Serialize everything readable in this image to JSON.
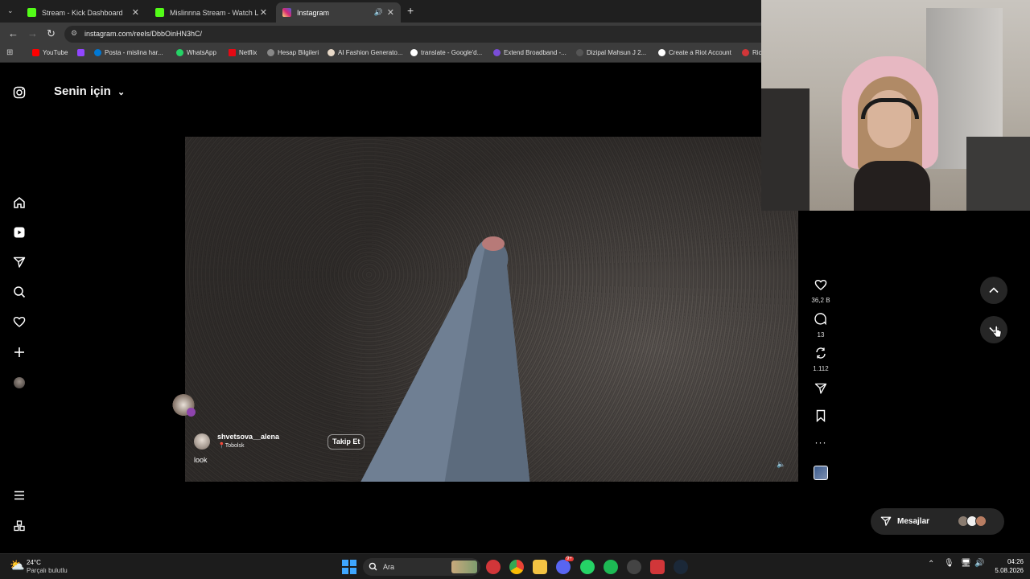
{
  "tabs": [
    {
      "label": "Stream - Kick Dashboard"
    },
    {
      "label": "Mislinnna Stream - Watch Live"
    },
    {
      "label": "Instagram"
    }
  ],
  "address": {
    "url": "instagram.com/reels/DbbOinHN3hC/"
  },
  "bookmarks": [
    {
      "label": "YouTube"
    },
    {
      "label": "Posta - mislina har..."
    },
    {
      "label": "WhatsApp"
    },
    {
      "label": "Netflix"
    },
    {
      "label": "Hesap Bilgileri"
    },
    {
      "label": "AI Fashion Generato..."
    },
    {
      "label": "translate - Google'd..."
    },
    {
      "label": "Extend Broadband -..."
    },
    {
      "label": "Dizipal Mahsun J 2..."
    },
    {
      "label": "Create a Riot Account"
    },
    {
      "label": "Rick"
    }
  ],
  "feed": {
    "title": "Senin için"
  },
  "post": {
    "username": "shvetsova__alena",
    "location": "Tobolsk",
    "follow_label": "Takip Et",
    "caption": "look"
  },
  "actions": {
    "likes": "36,2 B",
    "comments": "13",
    "reposts": "1.112"
  },
  "messages": {
    "label": "Mesajlar"
  },
  "taskbar": {
    "weather_temp": "24°C",
    "weather_desc": "Parçalı bulutlu",
    "search_placeholder": "Ara",
    "time": "04:26",
    "date": "5.08.2026",
    "discord_badge": "9+"
  },
  "colors": {
    "kick": "#53fc18",
    "instagram": "#d62976",
    "accent_blue": "#0a84ff"
  }
}
